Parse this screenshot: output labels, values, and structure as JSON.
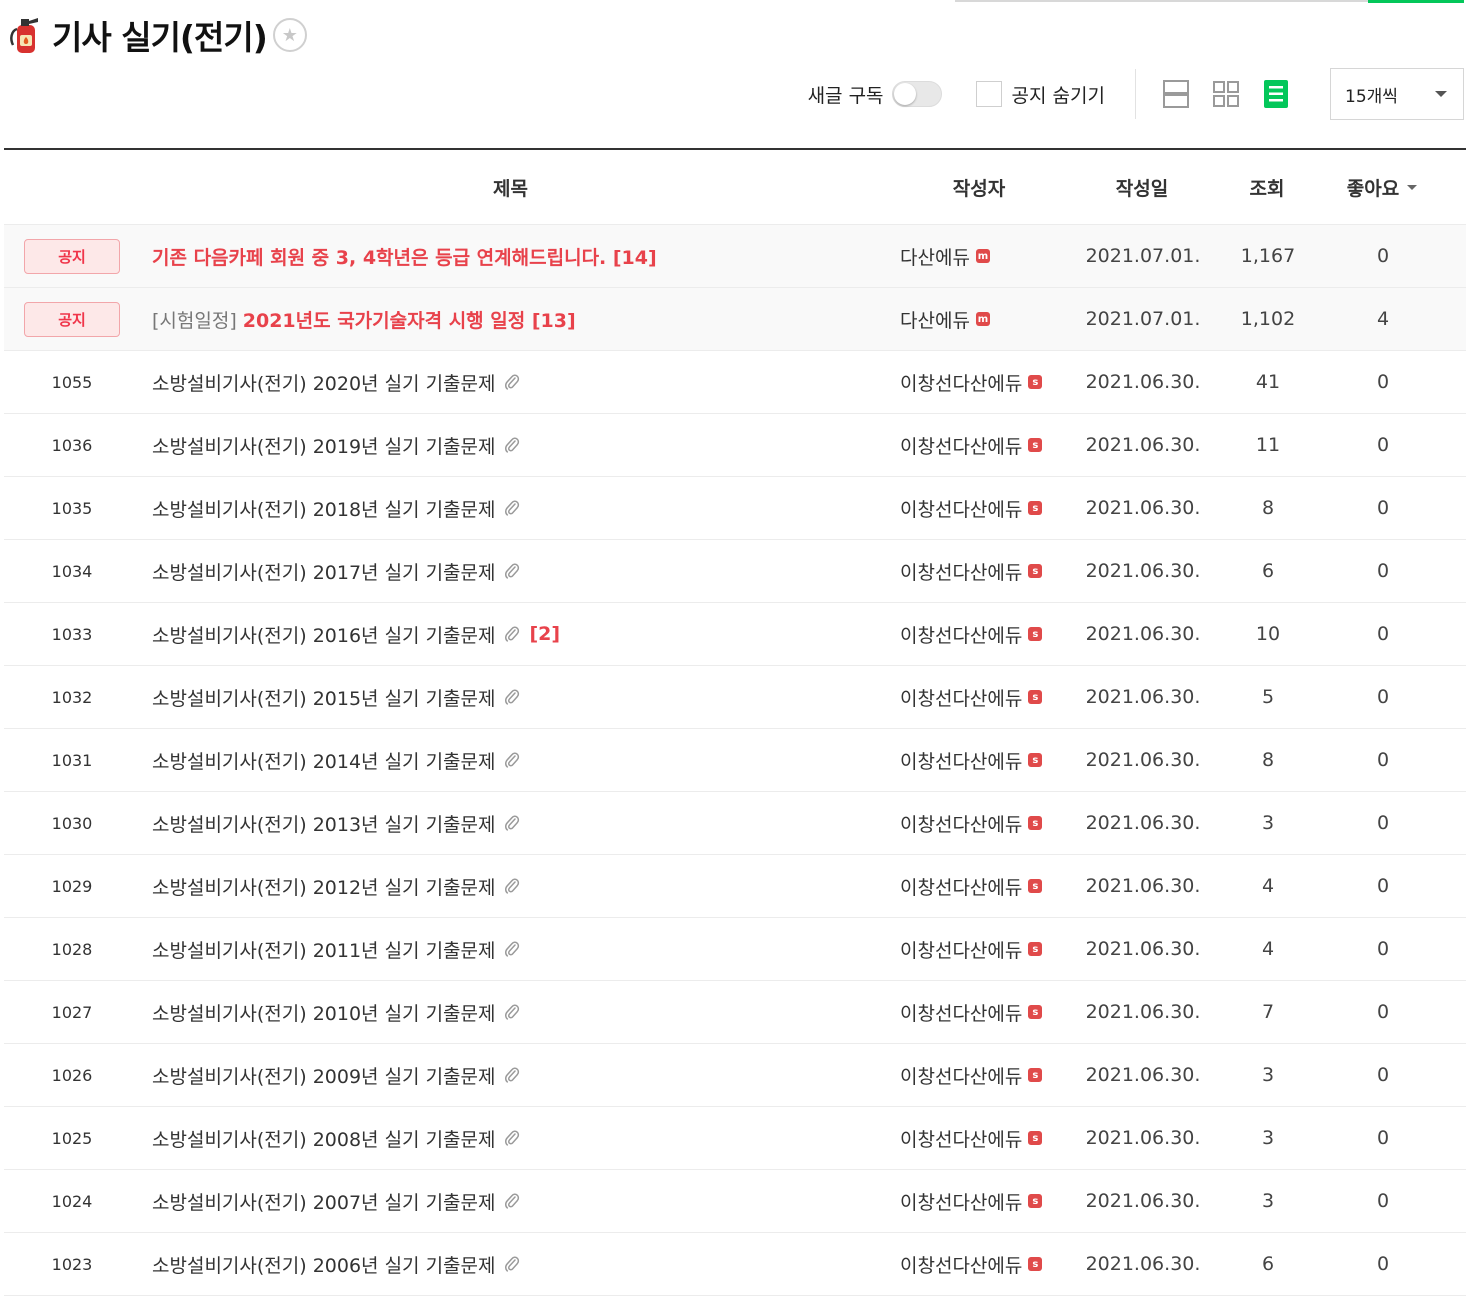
{
  "board": {
    "title": "기사 실기(전기)",
    "favorite_icon": "star-icon"
  },
  "toolbar": {
    "subscribe_label": "새글 구독",
    "subscribe_on": false,
    "hide_notice_label": "공지 숨기기",
    "hide_notice_checked": false,
    "views": [
      "list-view-icon",
      "album-view-icon",
      "card-view-icon"
    ],
    "active_view": "card-view-icon",
    "per_page": "15개씩",
    "accent_color": "#03c75a"
  },
  "table": {
    "headers": {
      "title": "제목",
      "writer": "작성자",
      "date": "작성일",
      "views": "조회",
      "likes": "좋아요"
    },
    "notices": [
      {
        "badge": "공지",
        "prefix": "",
        "title": "기존 다음카페 회원 중 3, 4학년은 등급 연계해드립니다. [14]",
        "writer": "다산에듀",
        "date": "2021.07.01.",
        "views": "1,167",
        "likes": "0"
      },
      {
        "badge": "공지",
        "prefix": "[시험일정]",
        "title": "2021년도 국가기술자격 시행 일정 [13]",
        "writer": "다산에듀",
        "date": "2021.07.01.",
        "views": "1,102",
        "likes": "4"
      }
    ],
    "rows": [
      {
        "no": "1055",
        "title": "소방설비기사(전기) 2020년 실기 기출문제",
        "comments": "",
        "writer": "이창선다산에듀",
        "date": "2021.06.30.",
        "views": "41",
        "likes": "0"
      },
      {
        "no": "1036",
        "title": "소방설비기사(전기) 2019년 실기 기출문제",
        "comments": "",
        "writer": "이창선다산에듀",
        "date": "2021.06.30.",
        "views": "11",
        "likes": "0"
      },
      {
        "no": "1035",
        "title": "소방설비기사(전기) 2018년 실기 기출문제",
        "comments": "",
        "writer": "이창선다산에듀",
        "date": "2021.06.30.",
        "views": "8",
        "likes": "0"
      },
      {
        "no": "1034",
        "title": "소방설비기사(전기) 2017년 실기 기출문제",
        "comments": "",
        "writer": "이창선다산에듀",
        "date": "2021.06.30.",
        "views": "6",
        "likes": "0"
      },
      {
        "no": "1033",
        "title": "소방설비기사(전기) 2016년 실기 기출문제",
        "comments": "[2]",
        "writer": "이창선다산에듀",
        "date": "2021.06.30.",
        "views": "10",
        "likes": "0"
      },
      {
        "no": "1032",
        "title": "소방설비기사(전기) 2015년 실기 기출문제",
        "comments": "",
        "writer": "이창선다산에듀",
        "date": "2021.06.30.",
        "views": "5",
        "likes": "0"
      },
      {
        "no": "1031",
        "title": "소방설비기사(전기) 2014년 실기 기출문제",
        "comments": "",
        "writer": "이창선다산에듀",
        "date": "2021.06.30.",
        "views": "8",
        "likes": "0"
      },
      {
        "no": "1030",
        "title": "소방설비기사(전기) 2013년 실기 기출문제",
        "comments": "",
        "writer": "이창선다산에듀",
        "date": "2021.06.30.",
        "views": "3",
        "likes": "0"
      },
      {
        "no": "1029",
        "title": "소방설비기사(전기) 2012년 실기 기출문제",
        "comments": "",
        "writer": "이창선다산에듀",
        "date": "2021.06.30.",
        "views": "4",
        "likes": "0"
      },
      {
        "no": "1028",
        "title": "소방설비기사(전기) 2011년 실기 기출문제",
        "comments": "",
        "writer": "이창선다산에듀",
        "date": "2021.06.30.",
        "views": "4",
        "likes": "0"
      },
      {
        "no": "1027",
        "title": "소방설비기사(전기) 2010년 실기 기출문제",
        "comments": "",
        "writer": "이창선다산에듀",
        "date": "2021.06.30.",
        "views": "7",
        "likes": "0"
      },
      {
        "no": "1026",
        "title": "소방설비기사(전기) 2009년 실기 기출문제",
        "comments": "",
        "writer": "이창선다산에듀",
        "date": "2021.06.30.",
        "views": "3",
        "likes": "0"
      },
      {
        "no": "1025",
        "title": "소방설비기사(전기) 2008년 실기 기출문제",
        "comments": "",
        "writer": "이창선다산에듀",
        "date": "2021.06.30.",
        "views": "3",
        "likes": "0"
      },
      {
        "no": "1024",
        "title": "소방설비기사(전기) 2007년 실기 기출문제",
        "comments": "",
        "writer": "이창선다산에듀",
        "date": "2021.06.30.",
        "views": "3",
        "likes": "0"
      },
      {
        "no": "1023",
        "title": "소방설비기사(전기) 2006년 실기 기출문제",
        "comments": "",
        "writer": "이창선다산에듀",
        "date": "2021.06.30.",
        "views": "6",
        "likes": "0"
      }
    ]
  }
}
